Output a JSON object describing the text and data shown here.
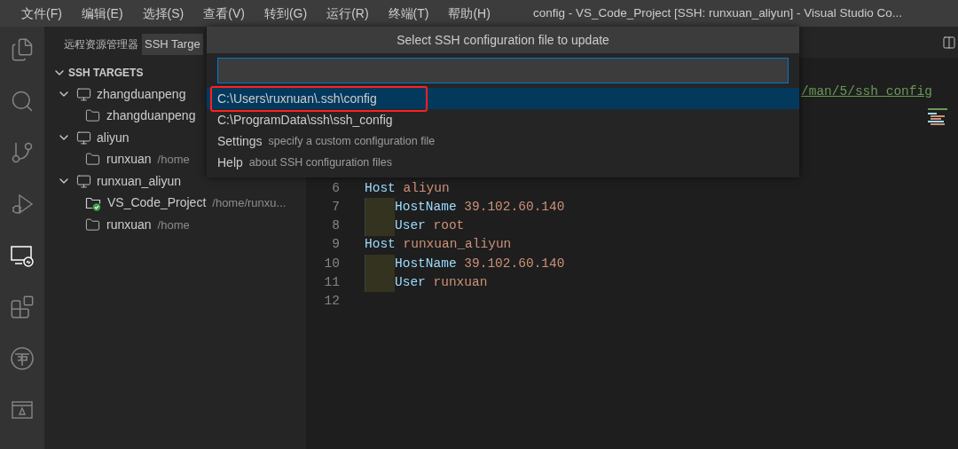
{
  "title_bar": {
    "menus": [
      "文件(F)",
      "编辑(E)",
      "选择(S)",
      "查看(V)",
      "转到(G)",
      "运行(R)",
      "终端(T)",
      "帮助(H)"
    ],
    "title": "config - VS_Code_Project [SSH: runxuan_aliyun] - Visual Studio Co..."
  },
  "activity_bar": [
    {
      "kind": "explorer",
      "selected": false
    },
    {
      "kind": "search",
      "selected": false
    },
    {
      "kind": "source-control",
      "selected": false
    },
    {
      "kind": "run",
      "selected": false
    },
    {
      "kind": "remote",
      "selected": true
    },
    {
      "kind": "extensions",
      "selected": false
    },
    {
      "kind": "emblem",
      "selected": false
    },
    {
      "kind": "panel",
      "selected": false
    }
  ],
  "sidebar": {
    "title": "远程资源管理器",
    "dropdown": "SSH Targe",
    "section": {
      "title": "SSH TARGETS",
      "expanded": true
    },
    "tree": [
      {
        "label": "zhangduanpeng",
        "expanded": true,
        "children": [
          {
            "label": "zhangduanpeng",
            "connected": false
          }
        ]
      },
      {
        "label": "aliyun",
        "expanded": true,
        "children": [
          {
            "label": "runxuan",
            "detail": "/home",
            "connected": false
          }
        ]
      },
      {
        "label": "runxuan_aliyun",
        "expanded": true,
        "children": [
          {
            "label": "VS_Code_Project",
            "detail": "/home/runxu...",
            "connected": true
          },
          {
            "label": "runxuan",
            "detail": "/home",
            "connected": false
          }
        ]
      }
    ]
  },
  "quick_pick": {
    "title": "Select SSH configuration file to update",
    "items": [
      {
        "label": "C:\\Users\\ruxnuan\\.ssh\\config",
        "selected": true,
        "outlined": true
      },
      {
        "label": "C:\\ProgramData\\ssh\\ssh_config",
        "selected": false,
        "outlined": false
      },
      {
        "label": "Settings",
        "description": "specify a custom configuration file",
        "selected": false,
        "outlined": false
      },
      {
        "label": "Help",
        "description": "about SSH configuration files",
        "selected": false,
        "outlined": false
      }
    ]
  },
  "editor": {
    "link_tail": "/man/5/ssh_config",
    "lines": [
      {
        "number": "6",
        "indent": false,
        "tokens": [
          {
            "text": "Host",
            "kind": "keyword"
          },
          {
            "text": "aliyun",
            "kind": "value"
          }
        ]
      },
      {
        "number": "7",
        "indent": true,
        "tokens": [
          {
            "text": "HostName",
            "kind": "keyword"
          },
          {
            "text": "39.102.60.140",
            "kind": "value"
          }
        ]
      },
      {
        "number": "8",
        "indent": true,
        "tokens": [
          {
            "text": "User",
            "kind": "keyword"
          },
          {
            "text": "root",
            "kind": "value"
          }
        ]
      },
      {
        "number": "9",
        "indent": false,
        "tokens": [
          {
            "text": "Host",
            "kind": "keyword"
          },
          {
            "text": "runxuan_aliyun",
            "kind": "value"
          }
        ]
      },
      {
        "number": "10",
        "indent": true,
        "tokens": [
          {
            "text": "HostName",
            "kind": "keyword"
          },
          {
            "text": "39.102.60.140",
            "kind": "value"
          }
        ]
      },
      {
        "number": "11",
        "indent": true,
        "tokens": [
          {
            "text": "User",
            "kind": "keyword"
          },
          {
            "text": "runxuan",
            "kind": "value"
          }
        ]
      },
      {
        "number": "12",
        "indent": false
      }
    ]
  }
}
